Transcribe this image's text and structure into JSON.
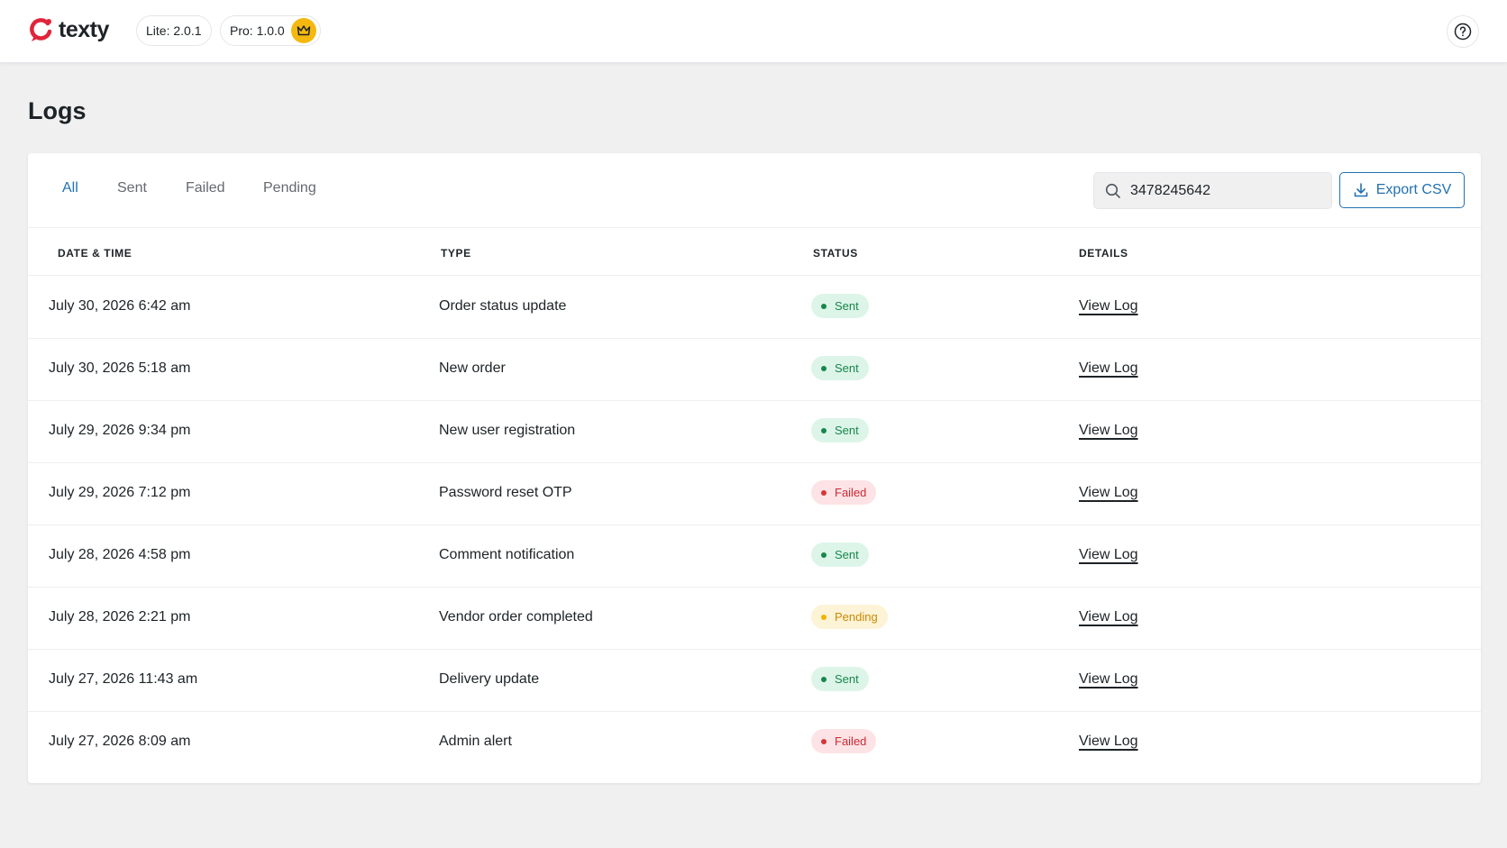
{
  "header": {
    "logo_text": "texty",
    "lite_version": "Lite: 2.0.1",
    "pro_version": "Pro: 1.0.0"
  },
  "page": {
    "title": "Logs"
  },
  "tabs": [
    {
      "label": "All",
      "active": true
    },
    {
      "label": "Sent",
      "active": false
    },
    {
      "label": "Failed",
      "active": false
    },
    {
      "label": "Pending",
      "active": false
    }
  ],
  "search": {
    "value": "3478245642"
  },
  "export": {
    "label": "Export CSV"
  },
  "table": {
    "headers": {
      "date": "DATE & TIME",
      "type": "TYPE",
      "status": "STATUS",
      "details": "DETAILS"
    },
    "rows": [
      {
        "date": "July 30, 2026 6:42 am",
        "type": "Order status update",
        "status": "Sent",
        "status_kind": "sent",
        "details": "View Log"
      },
      {
        "date": "July 30, 2026 5:18 am",
        "type": "New order",
        "status": "Sent",
        "status_kind": "sent",
        "details": "View Log"
      },
      {
        "date": "July 29, 2026 9:34 pm",
        "type": "New user registration",
        "status": "Sent",
        "status_kind": "sent",
        "details": "View Log"
      },
      {
        "date": "July 29, 2026 7:12 pm",
        "type": "Password reset OTP",
        "status": "Failed",
        "status_kind": "failed",
        "details": "View Log"
      },
      {
        "date": "July 28, 2026 4:58 pm",
        "type": "Comment notification",
        "status": "Sent",
        "status_kind": "sent",
        "details": "View Log"
      },
      {
        "date": "July 28, 2026 2:21 pm",
        "type": "Vendor order completed",
        "status": "Pending",
        "status_kind": "pending",
        "details": "View Log"
      },
      {
        "date": "July 27, 2026 11:43 am",
        "type": "Delivery update",
        "status": "Sent",
        "status_kind": "sent",
        "details": "View Log"
      },
      {
        "date": "July 27, 2026 8:09 am",
        "type": "Admin alert",
        "status": "Failed",
        "status_kind": "failed",
        "details": "View Log"
      }
    ]
  },
  "colors": {
    "accent": "#2271b1",
    "brand": "#e0243a",
    "crown": "#f5b80f",
    "sent": "#18864b",
    "failed": "#d63638",
    "pending": "#f0b400"
  },
  "icons": {
    "logo": "texty-logo-icon",
    "crown": "crown-icon",
    "help": "help-circle-icon",
    "search": "search-icon",
    "download": "download-icon"
  }
}
